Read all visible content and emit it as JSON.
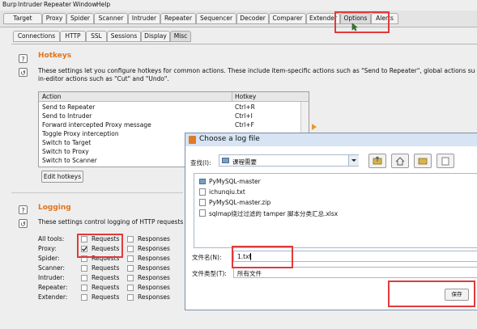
{
  "menubar": [
    "Burp",
    "Intruder",
    "Repeater",
    "Window",
    "Help"
  ],
  "main_tabs": [
    "Target",
    "Proxy",
    "Spider",
    "Scanner",
    "Intruder",
    "Repeater",
    "Sequencer",
    "Decoder",
    "Comparer",
    "Extender",
    "Options",
    "Alerts"
  ],
  "sub_tabs": [
    "Connections",
    "HTTP",
    "SSL",
    "Sessions",
    "Display",
    "Misc"
  ],
  "hotkeys": {
    "title": "Hotkeys",
    "desc1": "These settings let you configure hotkeys for common actions. These include item-specific actions such as \"Send to Repeater\", global actions such as \"Switc",
    "desc2": "in-editor actions such as \"Cut\" and \"Undo\".",
    "col_action": "Action",
    "col_hotkey": "Hotkey",
    "rows": [
      {
        "action": "Send to Repeater",
        "hotkey": "Ctrl+R"
      },
      {
        "action": "Send to Intruder",
        "hotkey": "Ctrl+I"
      },
      {
        "action": "Forward intercepted Proxy message",
        "hotkey": "Ctrl+F"
      },
      {
        "action": "Toggle Proxy interception",
        "hotkey": ""
      },
      {
        "action": "Switch to Target",
        "hotkey": ""
      },
      {
        "action": "Switch to Proxy",
        "hotkey": ""
      },
      {
        "action": "Switch to Scanner",
        "hotkey": ""
      }
    ],
    "edit_button": "Edit hotkeys"
  },
  "logging": {
    "title": "Logging",
    "desc": "These settings control logging of HTTP requests and",
    "requests_label": "Requests",
    "responses_label": "Responses",
    "rows": [
      {
        "tool": "All tools:",
        "requests": false
      },
      {
        "tool": "Proxy:",
        "requests": true
      },
      {
        "tool": "Spider:",
        "requests": false
      },
      {
        "tool": "Scanner:",
        "requests": false
      },
      {
        "tool": "Intruder:",
        "requests": false
      },
      {
        "tool": "Repeater:",
        "requests": false
      },
      {
        "tool": "Extender:",
        "requests": false
      }
    ]
  },
  "dialog": {
    "title": "Choose a log file",
    "lookin_label": "查找(I):",
    "lookin_value": "课程需要",
    "files": [
      {
        "name": "PyMySQL-master",
        "type": "folder"
      },
      {
        "name": "ichunqiu.txt",
        "type": "file"
      },
      {
        "name": "PyMySQL-master.zip",
        "type": "file"
      },
      {
        "name": "sqlmap绕过过滤的 tamper 脚本分类汇总.xlsx",
        "type": "file"
      }
    ],
    "filename_label": "文件名(N):",
    "filename_value": "1.txt",
    "filetype_label": "文件类型(T):",
    "filetype_value": "所有文件",
    "save_button": "保存"
  },
  "colors": {
    "heading": "#e2741c",
    "highlight": "#e23a3a",
    "dialog_title_bg": "#d6e4f4"
  }
}
